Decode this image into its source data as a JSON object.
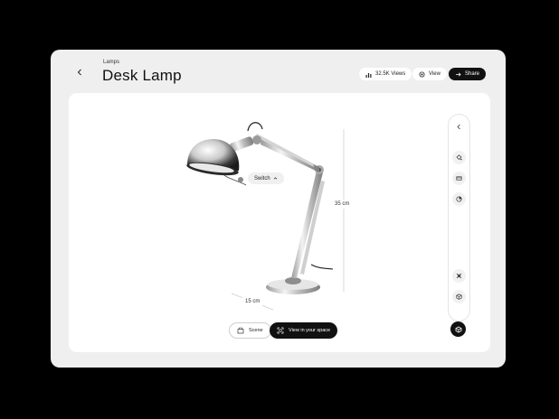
{
  "header": {
    "category": "Lamps",
    "title": "Desk Lamp",
    "views_label": "32.5K Views",
    "view_label": "View",
    "share_label": "Share"
  },
  "viewer": {
    "switch_label": "Switch",
    "height_dimension": "35 cm",
    "width_dimension": "15 cm"
  },
  "actions": {
    "scene_label": "Scene",
    "ar_label": "View in your space"
  },
  "toolbar": {
    "tools": [
      "chevron-left-icon",
      "paint-bucket-icon",
      "material-icon",
      "color-wheel-icon",
      "rotate-icon",
      "cube-icon"
    ]
  },
  "colors": {
    "accent": "#111111",
    "stage": "#ffffff",
    "window": "#efefef"
  }
}
